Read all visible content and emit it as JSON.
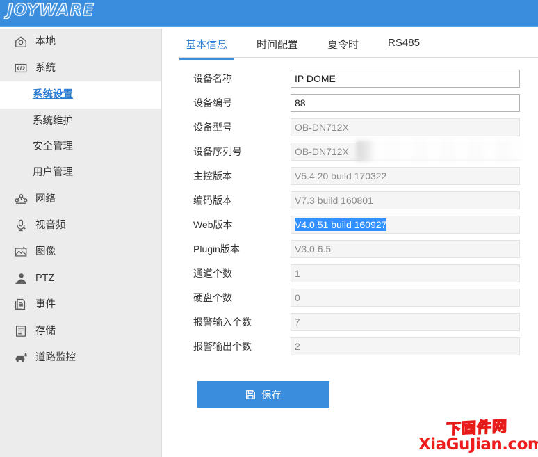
{
  "header": {
    "logo_text": "JOYWARE",
    "bg_color": "#3a8cdc"
  },
  "sidebar": {
    "items": [
      {
        "label": "本地",
        "icon": "home-icon",
        "level": "top",
        "active": false
      },
      {
        "label": "系统",
        "icon": "code-icon",
        "level": "top",
        "active": false
      },
      {
        "label": "系统设置",
        "icon": "",
        "level": "sub",
        "active": true
      },
      {
        "label": "系统维护",
        "icon": "",
        "level": "sub",
        "active": false
      },
      {
        "label": "安全管理",
        "icon": "",
        "level": "sub",
        "active": false
      },
      {
        "label": "用户管理",
        "icon": "",
        "level": "sub",
        "active": false
      },
      {
        "label": "网络",
        "icon": "network-icon",
        "level": "top",
        "active": false
      },
      {
        "label": "视音频",
        "icon": "microphone-icon",
        "level": "top",
        "active": false
      },
      {
        "label": "图像",
        "icon": "image-icon",
        "level": "top",
        "active": false
      },
      {
        "label": "PTZ",
        "icon": "person-icon",
        "level": "top",
        "active": false
      },
      {
        "label": "事件",
        "icon": "documents-icon",
        "level": "top",
        "active": false
      },
      {
        "label": "存储",
        "icon": "storage-icon",
        "level": "top",
        "active": false
      },
      {
        "label": "道路监控",
        "icon": "car-icon",
        "level": "top",
        "active": false
      }
    ]
  },
  "main": {
    "tabs": [
      {
        "label": "基本信息",
        "active": true
      },
      {
        "label": "时间配置",
        "active": false
      },
      {
        "label": "夏令时",
        "active": false
      },
      {
        "label": "RS485",
        "active": false
      }
    ],
    "fields": [
      {
        "label": "设备名称",
        "value": "IP DOME",
        "readonly": false,
        "selected": false,
        "masked": false
      },
      {
        "label": "设备编号",
        "value": "88",
        "readonly": false,
        "selected": false,
        "masked": false
      },
      {
        "label": "设备型号",
        "value": "OB-DN712X",
        "readonly": true,
        "selected": false,
        "masked": false
      },
      {
        "label": "设备序列号",
        "value": "OB-DN712X",
        "readonly": true,
        "selected": false,
        "masked": true
      },
      {
        "label": "主控版本",
        "value": "V5.4.20 build 170322",
        "readonly": true,
        "selected": false,
        "masked": false
      },
      {
        "label": "编码版本",
        "value": "V7.3 build 160801",
        "readonly": true,
        "selected": false,
        "masked": false
      },
      {
        "label": "Web版本",
        "value": "V4.0.51 build 160927",
        "readonly": true,
        "selected": true,
        "masked": false
      },
      {
        "label": "Plugin版本",
        "value": "V3.0.6.5",
        "readonly": true,
        "selected": false,
        "masked": false
      },
      {
        "label": "通道个数",
        "value": "1",
        "readonly": true,
        "selected": false,
        "masked": false
      },
      {
        "label": "硬盘个数",
        "value": "0",
        "readonly": true,
        "selected": false,
        "masked": false
      },
      {
        "label": "报警输入个数",
        "value": "7",
        "readonly": true,
        "selected": false,
        "masked": false
      },
      {
        "label": "报警输出个数",
        "value": "2",
        "readonly": true,
        "selected": false,
        "masked": false
      }
    ],
    "save_label": "保存"
  },
  "watermark": {
    "cn_text": "下固件网",
    "en_text": "XiaGuJian.com",
    "color": "#ee1c1c"
  }
}
